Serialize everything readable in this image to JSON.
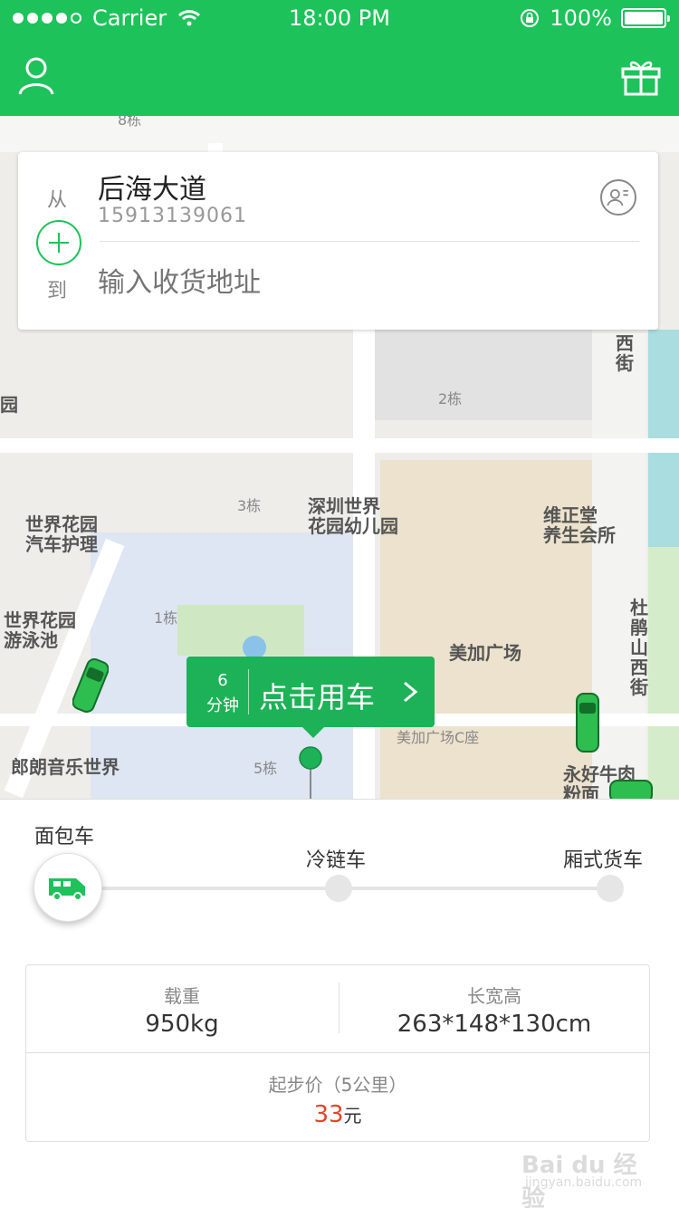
{
  "status_bar": {
    "carrier": "Carrier",
    "time": "18:00 PM",
    "battery": "100%",
    "battery_level": 1.0,
    "signal_bars_filled": 4,
    "signal_bars_total": 5
  },
  "header": {
    "user_icon": "user-icon",
    "gift_icon": "gift-icon"
  },
  "address": {
    "from_label": "从",
    "to_label": "到",
    "from_title": "后海大道",
    "from_phone": "15913139061",
    "to_placeholder": "输入收货地址",
    "contact_icon": "contact-card-icon",
    "add_icon": "plus-circle-icon"
  },
  "map_labels": {
    "bldg_8": "8栋",
    "xijie_1": "西",
    "xijie_2": "街",
    "bldg_2": "2栋",
    "bldg_3": "3栋",
    "kindergarten_1": "深圳世界",
    "kindergarten_2": "花园幼儿园",
    "health_1": "维正堂",
    "health_2": "养生会所",
    "car_care_1": "世界花园",
    "car_care_2": "汽车护理",
    "pool_1": "世界花园",
    "pool_2": "游泳池",
    "bldg_1": "1栋",
    "road_1": "杜",
    "road_2": "鹃",
    "road_3": "山",
    "road_4": "西",
    "road_5": "街",
    "plaza": "美加广场",
    "plaza_c": "美加广场C座",
    "music": "郎朗音乐世界",
    "bldg_5": "5栋",
    "beef_1": "永好牛肉",
    "beef_2": "粉面",
    "left_edge": "园"
  },
  "call_car": {
    "eta_value": "6",
    "eta_unit": "分钟",
    "label": "点击用车"
  },
  "vehicles": {
    "selected": "面包车",
    "options": [
      "面包车",
      "冷链车",
      "厢式货车"
    ],
    "selected_icon": "van-icon"
  },
  "specs": {
    "load_label": "载重",
    "load_value": "950kg",
    "size_label": "长宽高",
    "size_value": "263*148*130cm",
    "base_price_label": "起步价（5公里）",
    "base_price_value": "33",
    "base_price_unit": "元"
  },
  "watermark": {
    "line1": "Bai du 经验",
    "line2": "jingyan.baidu.com"
  },
  "colors": {
    "brand_green": "#1dc35a",
    "price_red": "#e0452c"
  }
}
